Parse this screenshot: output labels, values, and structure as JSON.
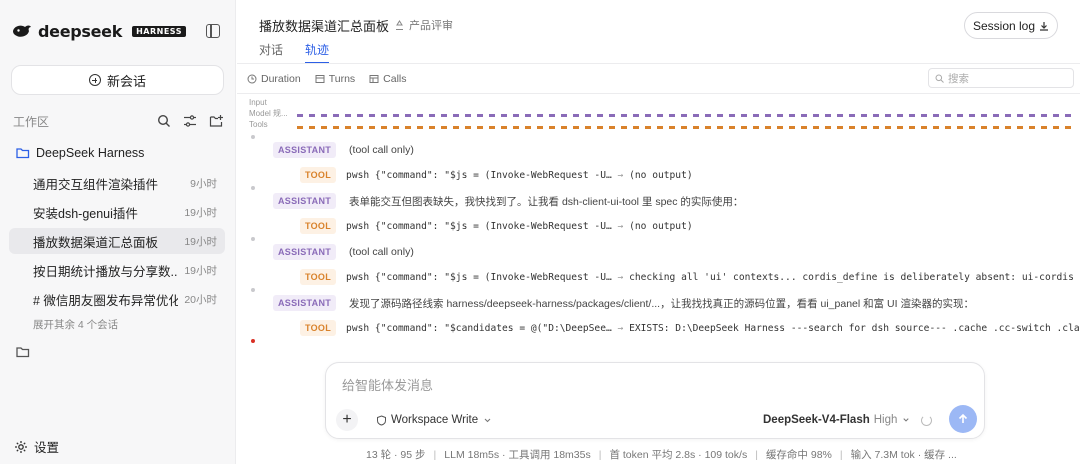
{
  "app": {
    "brand": "deepseek",
    "badge": "HARNESS",
    "brand_color": "#2c5fe6"
  },
  "sidebar": {
    "new_chat": "新会话",
    "workspace_title": "工作区",
    "project": "DeepSeek Harness",
    "conversations": [
      {
        "title": "通用交互组件渲染插件",
        "time": "9小时"
      },
      {
        "title": "安装dsh-genui插件",
        "time": "19小时"
      },
      {
        "title": "播放数据渠道汇总面板",
        "time": "19小时"
      },
      {
        "title": "按日期统计播放与分享数...",
        "time": "19小时"
      },
      {
        "title": "# 微信朋友圈发布异常优化...",
        "time": "20小时"
      }
    ],
    "active_index": 2,
    "expand_more": "展开其余 4 个会话",
    "settings": "设置"
  },
  "header": {
    "title": "播放数据渠道汇总面板",
    "rate": "产品评审",
    "session_log": "Session log",
    "tabs": [
      {
        "label": "对话"
      },
      {
        "label": "轨迹"
      }
    ],
    "active_tab": 1
  },
  "filters": {
    "duration": "Duration",
    "turns": "Turns",
    "calls": "Calls",
    "search_placeholder": "搜索"
  },
  "timeline": {
    "labels": [
      "Input",
      "Model 规...",
      "Tools"
    ],
    "model_color": "#8a6bb8",
    "tool_color": "#d9822b"
  },
  "events": [
    {
      "role": "ASSISTANT",
      "text": "(tool call only)"
    },
    {
      "role": "TOOL",
      "cmd": "pwsh {\"command\": \"$js = (Invoke-WebRequest -U…",
      "arrow": "→",
      "out": "(no output)"
    },
    {
      "role": "ASSISTANT",
      "text": "表单能交互但图表缺失，我快找到了。让我看 dsh-client-ui-tool 里 spec 的实际使用："
    },
    {
      "role": "TOOL",
      "cmd": "pwsh {\"command\": \"$js = (Invoke-WebRequest -U…",
      "arrow": "→",
      "out": "(no output)"
    },
    {
      "role": "ASSISTANT",
      "text": "(tool call only)"
    },
    {
      "role": "TOOL",
      "cmd": "pwsh {\"command\": \"$js = (Invoke-WebRequest -U…",
      "arrow": "→",
      "out": "checking all 'ui' contexts... cordis_define is deliberately absent: ui-cordis r"
    },
    {
      "role": "ASSISTANT",
      "text": "发现了源码路径线索 harness/deepseek-harness/packages/client/...，让我找找真正的源码位置，看看 ui_panel 和富 UI 渲染器的实现："
    },
    {
      "role": "TOOL",
      "cmd": "pwsh {\"command\": \"$candidates = @(\"D:\\DeepSee…",
      "arrow": "→",
      "out": "EXISTS: D:\\DeepSeek Harness ---search for dsh source--- .cache .cc-switch .clau"
    }
  ],
  "composer": {
    "placeholder": "给智能体发消息",
    "mode": "Workspace Write",
    "model": "DeepSeek-V4-Flash",
    "level": "High"
  },
  "footer": {
    "rounds": "13 轮 · 95 步",
    "llm": "LLM 18m5s · 工具调用 18m35s",
    "first_token": "首 token 平均 2.8s · 109 tok/s",
    "cache": "缓存命中 98%",
    "input": "输入 7.3M tok · 缓存 ..."
  }
}
